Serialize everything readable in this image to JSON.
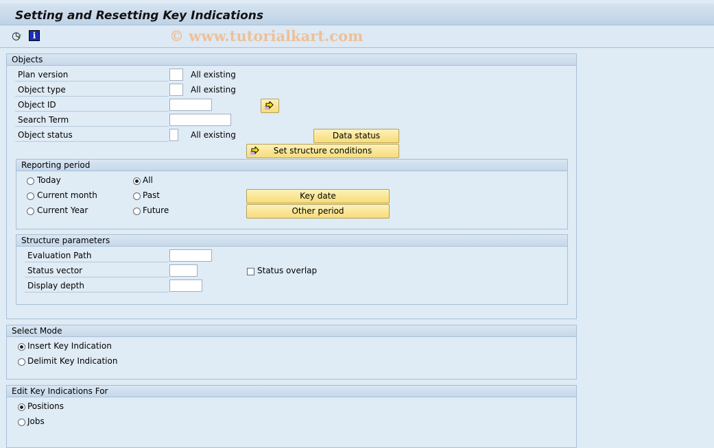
{
  "title": "Setting and Resetting Key Indications",
  "toolbar": {
    "icons": [
      "execute-clock-icon",
      "info-icon"
    ]
  },
  "watermark": "© www.tutorialkart.com",
  "objects": {
    "header": "Objects",
    "plan_version": {
      "label": "Plan version",
      "value": "",
      "note": "All existing"
    },
    "object_type": {
      "label": "Object type",
      "value": "",
      "note": "All existing"
    },
    "object_id": {
      "label": "Object ID",
      "value": ""
    },
    "search_term": {
      "label": "Search Term",
      "value": ""
    },
    "object_status": {
      "label": "Object status",
      "value": "",
      "note": "All existing"
    },
    "data_status_button": "Data status",
    "set_structure_button": "Set structure conditions"
  },
  "reporting_period": {
    "header": "Reporting period",
    "options": [
      {
        "label": "Today",
        "checked": false
      },
      {
        "label": "All",
        "checked": true
      },
      {
        "label": "Current month",
        "checked": false
      },
      {
        "label": "Past",
        "checked": false
      },
      {
        "label": "Current Year",
        "checked": false
      },
      {
        "label": "Future",
        "checked": false
      }
    ],
    "key_date_button": "Key date",
    "other_period_button": "Other period"
  },
  "structure_parameters": {
    "header": "Structure parameters",
    "evaluation_path": {
      "label": "Evaluation Path",
      "value": ""
    },
    "status_vector": {
      "label": "Status vector",
      "value": ""
    },
    "display_depth": {
      "label": "Display depth",
      "value": ""
    },
    "status_overlap": {
      "label": "Status overlap",
      "checked": false
    }
  },
  "select_mode": {
    "header": "Select Mode",
    "options": [
      {
        "label": "Insert Key Indication",
        "checked": true
      },
      {
        "label": "Delimit Key Indication",
        "checked": false
      }
    ]
  },
  "edit_for": {
    "header": "Edit Key Indications For",
    "options": [
      {
        "label": "Positions",
        "checked": true
      },
      {
        "label": "Jobs",
        "checked": false
      }
    ]
  }
}
